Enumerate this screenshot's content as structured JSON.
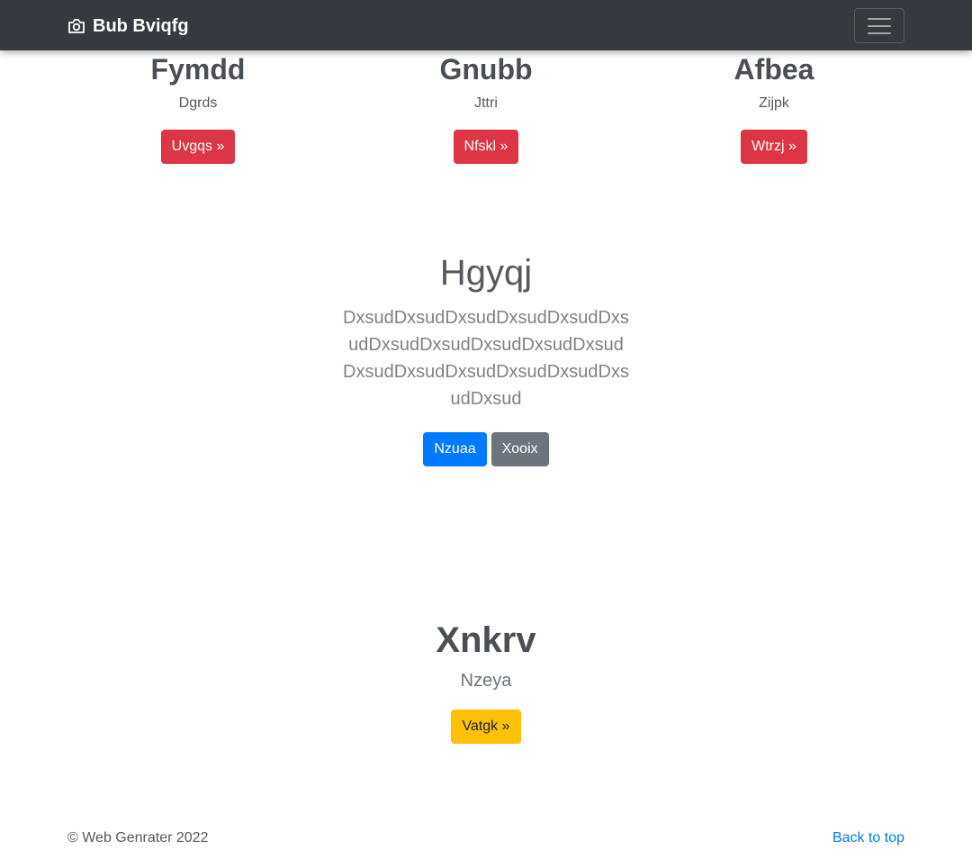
{
  "navbar": {
    "brand": "Bub Bviqfg",
    "brand_icon": "camera-icon",
    "toggler_icon": "hamburger-icon"
  },
  "features": [
    {
      "title": "Fymdd",
      "text": "Dgrds",
      "button": "Uvgqs »"
    },
    {
      "title": "Gnubb",
      "text": "Jttri",
      "button": "Nfskl »"
    },
    {
      "title": "Afbea",
      "text": "Zijpk",
      "button": "Wtrzj »"
    }
  ],
  "hero": {
    "title": "Hgyqj",
    "lead": "DxsudDxsudDxsudDxsudDxsudDxsudDxsudDxsudDxsudDxsudDxsudDxsudDxsudDxsudDxsudDxsudDxsudDxsud",
    "primary_button": "Nzuaa",
    "secondary_button": "Xooix"
  },
  "section2": {
    "title": "Xnkrv",
    "text": "Nzeya",
    "button": "Vatgk »"
  },
  "footer": {
    "copyright": "© Web Genrater 2022",
    "back_to_top": "Back to top"
  },
  "colors": {
    "navbar": "#343a40",
    "danger": "#dc3545",
    "primary": "#007bff",
    "secondary": "#6c757d",
    "warning": "#ffc107"
  }
}
